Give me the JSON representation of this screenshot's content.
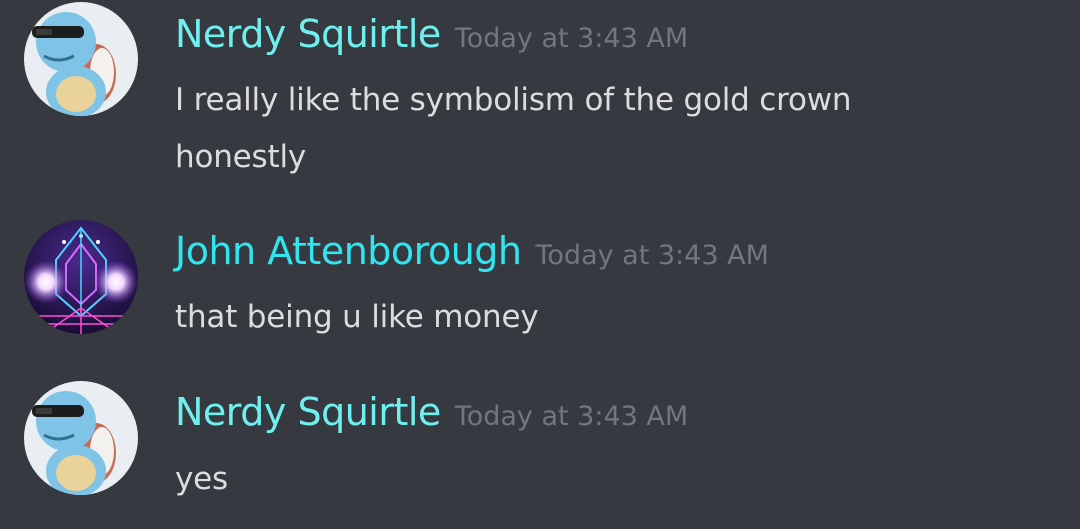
{
  "colors": {
    "background": "#36393f",
    "username_squirtle": "#6ff0ee",
    "username_john": "#2fe6f0",
    "timestamp": "#72767d",
    "message_text": "#dcddde"
  },
  "messages": [
    {
      "avatar_icon": "squirtle-sunglasses-avatar-icon",
      "username": "Nerdy Squirtle",
      "timestamp": "Today at 3:43 AM",
      "lines": [
        "I really like the symbolism of the gold crown",
        "honestly"
      ]
    },
    {
      "avatar_icon": "neon-synthwave-avatar-icon",
      "username": "John Attenborough",
      "timestamp": "Today at 3:43 AM",
      "lines": [
        "that being u like money"
      ]
    },
    {
      "avatar_icon": "squirtle-sunglasses-avatar-icon",
      "username": "Nerdy Squirtle",
      "timestamp": "Today at 3:43 AM",
      "lines": [
        "yes"
      ]
    }
  ]
}
